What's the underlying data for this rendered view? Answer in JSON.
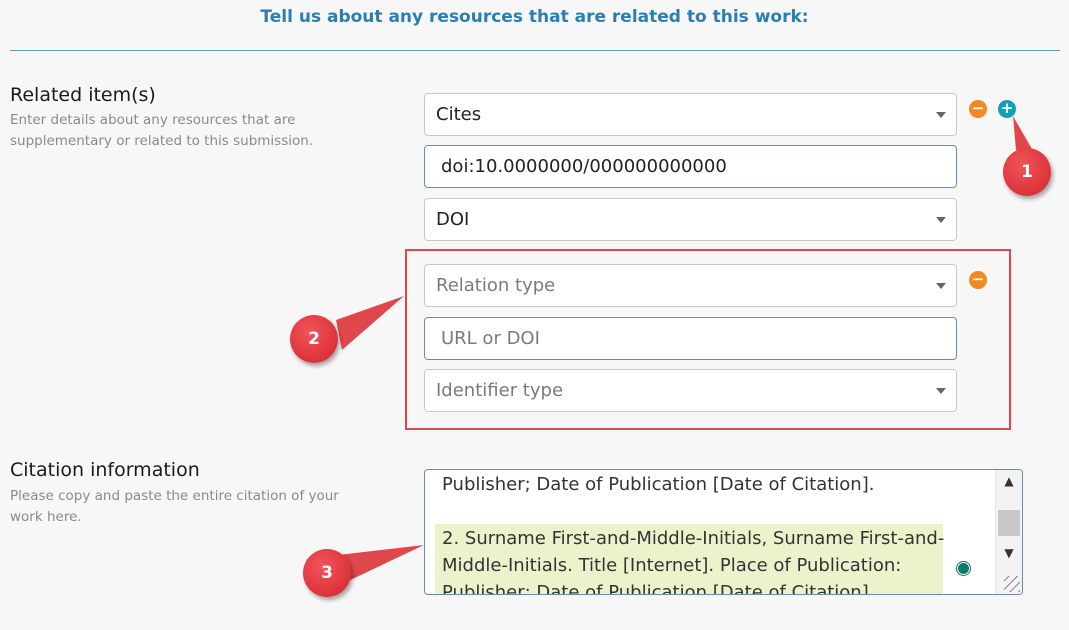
{
  "header": {
    "title": "Tell us about any resources that are related to this work:"
  },
  "related": {
    "title": "Related item(s)",
    "desc_line1": "Enter details about any resources that are",
    "desc_line2": "supplementary or related to this submission.",
    "item1": {
      "relation": "Cites",
      "url": "doi:10.0000000/000000000000",
      "idtype": "DOI"
    },
    "item2": {
      "relation_placeholder": "Relation type",
      "url_placeholder": "URL or DOI",
      "idtype_placeholder": "Identifier type"
    },
    "remove_symbol": "−",
    "add_symbol": "+"
  },
  "citation": {
    "title": "Citation information",
    "desc_line1": "Please copy and paste the entire citation of your",
    "desc_line2": "work here.",
    "lines": [
      "Publisher; Date of Publication [Date of Citation].",
      "2. Surname First-and-Middle-Initials, Surname First-and-",
      "Middle-Initials. Title [Internet]. Place of Publication:",
      "Publisher; Date of Publication [Date of Citation]."
    ]
  },
  "callouts": [
    "1",
    "2",
    "3"
  ],
  "colors": {
    "accent": "#2a7eb0",
    "remove": "#f08a21",
    "add": "#12a0b4",
    "callout": "#e0474c",
    "highlight": "#eef2cc"
  },
  "icons": [
    "chevron-down-icon",
    "minus-icon",
    "plus-icon",
    "scroll-up-icon",
    "scroll-down-icon",
    "resize-handle-icon"
  ]
}
